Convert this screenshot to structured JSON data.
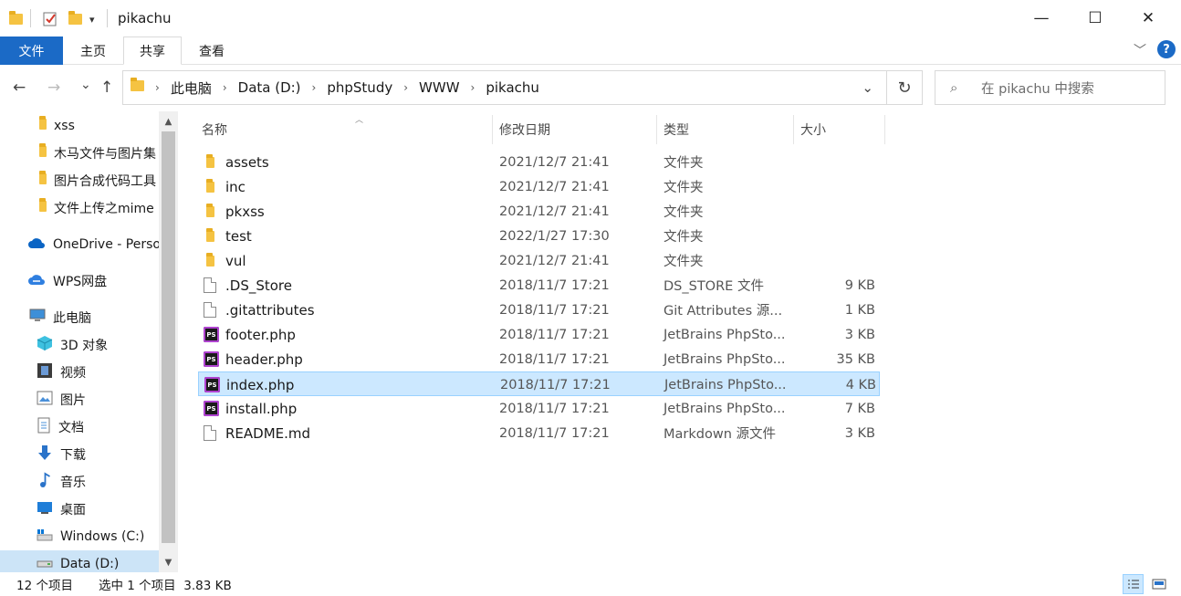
{
  "window": {
    "title": "pikachu"
  },
  "titlebar": {
    "minimize": "—",
    "maximize": "☐",
    "close": "✕",
    "qa_dropdown": "▾"
  },
  "ribbon": {
    "tabs": [
      {
        "label": "文件"
      },
      {
        "label": "主页"
      },
      {
        "label": "共享"
      },
      {
        "label": "查看"
      }
    ],
    "help": "?",
    "collapse": "﹀"
  },
  "nav": {
    "back": "←",
    "forward": "→",
    "recent": "⌄",
    "up": "↑"
  },
  "address": {
    "crumbs": [
      "此电脑",
      "Data (D:)",
      "phpStudy",
      "WWW",
      "pikachu"
    ],
    "dropdown": "⌄",
    "refresh": "↻"
  },
  "search": {
    "placeholder": "在 pikachu 中搜索",
    "icon": "⌕"
  },
  "navpane": {
    "items": [
      {
        "label": "xss",
        "icon": "folder-icon"
      },
      {
        "label": "木马文件与图片集",
        "icon": "folder-icon"
      },
      {
        "label": "图片合成代码工具",
        "icon": "folder-icon"
      },
      {
        "label": "文件上传之mime",
        "icon": "folder-icon"
      },
      {
        "label": "OneDrive - Personal",
        "icon": "onedrive-icon"
      },
      {
        "label": "WPS网盘",
        "icon": "wps-cloud-icon"
      },
      {
        "label": "此电脑",
        "icon": "computer-icon"
      },
      {
        "label": "3D 对象",
        "icon": "3d-objects-icon"
      },
      {
        "label": "视频",
        "icon": "video-icon"
      },
      {
        "label": "图片",
        "icon": "pictures-icon"
      },
      {
        "label": "文档",
        "icon": "documents-icon"
      },
      {
        "label": "下载",
        "icon": "downloads-icon"
      },
      {
        "label": "音乐",
        "icon": "music-icon"
      },
      {
        "label": "桌面",
        "icon": "desktop-icon"
      },
      {
        "label": "Windows (C:)",
        "icon": "windows-drive-icon"
      },
      {
        "label": "Data (D:)",
        "icon": "drive-icon"
      }
    ],
    "scroll_up": "▲",
    "scroll_down": "▼"
  },
  "columns": {
    "name": "名称",
    "date": "修改日期",
    "type": "类型",
    "size": "大小",
    "sort_indicator": "︿"
  },
  "files": [
    {
      "name": "assets",
      "date": "2021/12/7 21:41",
      "type": "文件夹",
      "size": "",
      "icon": "folder-icon"
    },
    {
      "name": "inc",
      "date": "2021/12/7 21:41",
      "type": "文件夹",
      "size": "",
      "icon": "folder-icon"
    },
    {
      "name": "pkxss",
      "date": "2021/12/7 21:41",
      "type": "文件夹",
      "size": "",
      "icon": "folder-icon"
    },
    {
      "name": "test",
      "date": "2022/1/27 17:30",
      "type": "文件夹",
      "size": "",
      "icon": "folder-icon"
    },
    {
      "name": "vul",
      "date": "2021/12/7 21:41",
      "type": "文件夹",
      "size": "",
      "icon": "folder-icon"
    },
    {
      "name": ".DS_Store",
      "date": "2018/11/7 17:21",
      "type": "DS_STORE 文件",
      "size": "9 KB",
      "icon": "file-icon"
    },
    {
      "name": ".gitattributes",
      "date": "2018/11/7 17:21",
      "type": "Git Attributes 源...",
      "size": "1 KB",
      "icon": "file-icon"
    },
    {
      "name": "footer.php",
      "date": "2018/11/7 17:21",
      "type": "JetBrains PhpSto...",
      "size": "3 KB",
      "icon": "phpstorm-icon"
    },
    {
      "name": "header.php",
      "date": "2018/11/7 17:21",
      "type": "JetBrains PhpSto...",
      "size": "35 KB",
      "icon": "phpstorm-icon"
    },
    {
      "name": "index.php",
      "date": "2018/11/7 17:21",
      "type": "JetBrains PhpSto...",
      "size": "4 KB",
      "icon": "phpstorm-icon",
      "selected": true
    },
    {
      "name": "install.php",
      "date": "2018/11/7 17:21",
      "type": "JetBrains PhpSto...",
      "size": "7 KB",
      "icon": "phpstorm-icon"
    },
    {
      "name": "README.md",
      "date": "2018/11/7 17:21",
      "type": "Markdown 源文件",
      "size": "3 KB",
      "icon": "file-icon"
    }
  ],
  "status": {
    "count": "12 个项目",
    "selection": "选中 1 个项目  3.83 KB"
  },
  "ps_label": "PS",
  "colors": {
    "accent": "#1b6ac6",
    "selection": "#cce8ff",
    "folder": "#f5c342"
  }
}
